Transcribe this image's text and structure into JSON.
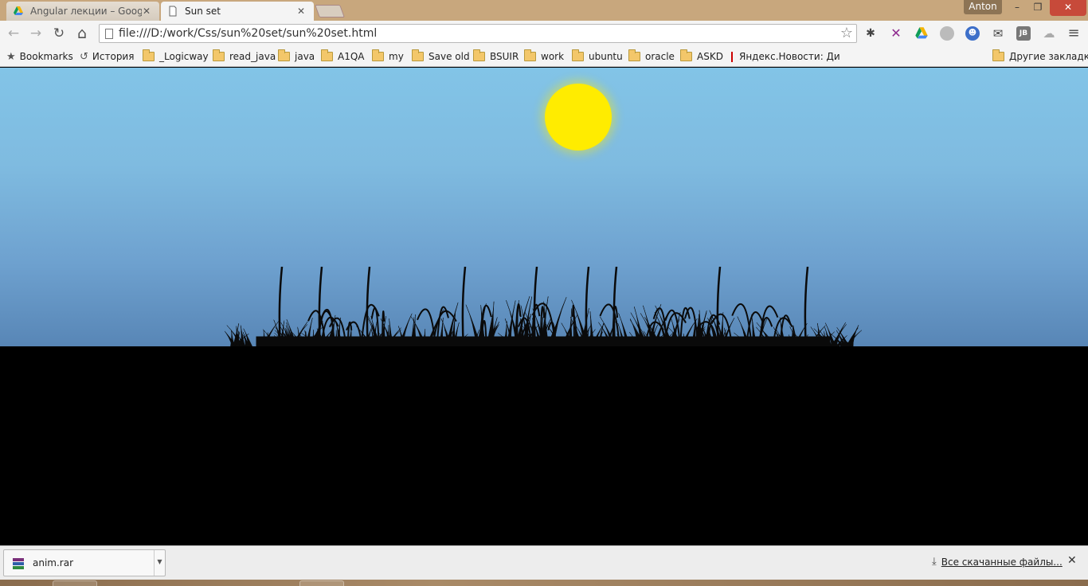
{
  "tabs": [
    {
      "title": "Angular лекции – Google",
      "icon": "google-drive-icon",
      "active": false
    },
    {
      "title": "Sun set",
      "icon": "page-icon",
      "active": true
    }
  ],
  "user": "Anton",
  "window_controls": {
    "minimize": "–",
    "restore": "❐",
    "close": "✕"
  },
  "toolbar": {
    "back_icon": "←",
    "forward_icon": "→",
    "reload_icon": "↻",
    "home_icon": "⌂",
    "url": "file:///D:/work/Css/sun%20set/sun%20set.html",
    "star_icon": "☆",
    "extensions": [
      "bug-icon",
      "x-icon",
      "google-drive-icon",
      "circle-icon",
      "shield-icon",
      "mail-icon",
      "jetbrains-icon",
      "cloud-icon"
    ],
    "menu_icon": "≡"
  },
  "bookmarks": {
    "items": [
      {
        "label": "Bookmarks",
        "type": "star"
      },
      {
        "label": "История",
        "type": "history"
      },
      {
        "label": "_Logicway",
        "type": "folder"
      },
      {
        "label": "read_java",
        "type": "folder"
      },
      {
        "label": "java",
        "type": "folder"
      },
      {
        "label": "A1QA",
        "type": "folder"
      },
      {
        "label": "my",
        "type": "folder"
      },
      {
        "label": "Save old",
        "type": "folder"
      },
      {
        "label": "BSUIR",
        "type": "folder"
      },
      {
        "label": "work",
        "type": "folder"
      },
      {
        "label": "ubuntu",
        "type": "folder"
      },
      {
        "label": "oracle",
        "type": "folder"
      },
      {
        "label": "ASKD",
        "type": "folder"
      },
      {
        "label": "Яндекс.Новости: Дин",
        "type": "page"
      }
    ],
    "other": "Другие закладки"
  },
  "page": {
    "sky_colors": [
      "#82c4e7",
      "#5886b6"
    ],
    "sun_color": "#ffec00",
    "ground_color": "#000000"
  },
  "downloads": {
    "file_name": "anim.rar",
    "all_label": "Все скачанные файлы...",
    "close_icon": "✕"
  }
}
